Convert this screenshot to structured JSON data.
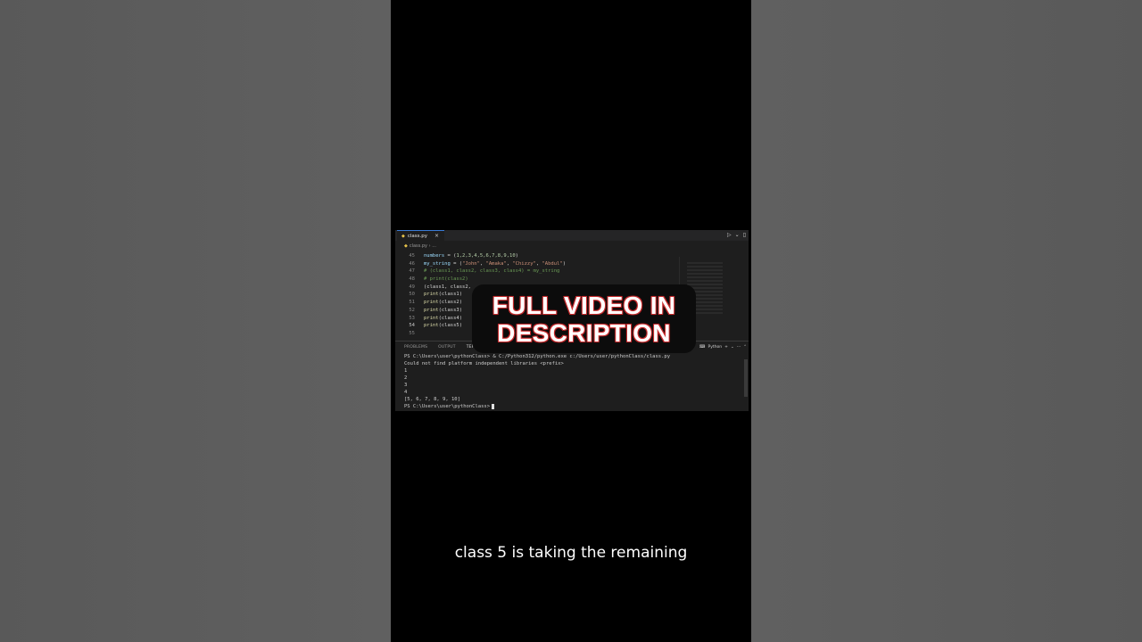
{
  "editor": {
    "tab_filename": "class.py",
    "tab_close": "×",
    "breadcrumb_file": "class.py",
    "breadcrumb_more": "...",
    "lines": [
      {
        "num": "45",
        "tokens": [
          [
            "var",
            "numbers"
          ],
          [
            "plain",
            " = ("
          ],
          [
            "num",
            "1,2,3,4,5,6,7,8,9,10"
          ],
          [
            "plain",
            ")"
          ]
        ]
      },
      {
        "num": "46",
        "tokens": [
          [
            "var",
            "my_string"
          ],
          [
            "plain",
            " = ("
          ],
          [
            "str",
            "\"John\""
          ],
          [
            "plain",
            ", "
          ],
          [
            "str",
            "\"Amaka\""
          ],
          [
            "plain",
            ", "
          ],
          [
            "str",
            "\"Chizzy\""
          ],
          [
            "plain",
            ", "
          ],
          [
            "str",
            "\"Abdul\""
          ],
          [
            "plain",
            ")"
          ]
        ]
      },
      {
        "num": "47",
        "tokens": [
          [
            "com",
            "# (class1, class2, class3, class4) = my_string"
          ]
        ]
      },
      {
        "num": "48",
        "tokens": [
          [
            "com",
            "# print(class2)"
          ]
        ]
      },
      {
        "num": "49",
        "tokens": [
          [
            "plain",
            "(class1, class2,"
          ]
        ]
      },
      {
        "num": "50",
        "tokens": [
          [
            "fn",
            "print"
          ],
          [
            "plain",
            "(class1)"
          ]
        ]
      },
      {
        "num": "51",
        "tokens": [
          [
            "fn",
            "print"
          ],
          [
            "plain",
            "(class2)"
          ]
        ]
      },
      {
        "num": "52",
        "tokens": [
          [
            "fn",
            "print"
          ],
          [
            "plain",
            "(class3)"
          ]
        ]
      },
      {
        "num": "53",
        "tokens": [
          [
            "fn",
            "print"
          ],
          [
            "plain",
            "(class4)"
          ]
        ]
      },
      {
        "num": "54",
        "tokens": [
          [
            "fn",
            "print"
          ],
          [
            "plain",
            "(class5)"
          ]
        ]
      },
      {
        "num": "55",
        "tokens": []
      }
    ]
  },
  "panel": {
    "tabs": [
      "PROBLEMS",
      "OUTPUT",
      "TERMINAL"
    ],
    "shell_label": "Python",
    "terminal_lines": [
      "PS C:\\Users\\user\\pythonClass> & C:/Python312/python.exe c:/Users/user/pythonClass/class.py",
      "Could not find platform independent libraries <prefix>",
      "1",
      "2",
      "3",
      "4",
      "[5, 6, 7, 8, 9, 10]"
    ],
    "prompt": "PS C:\\Users\\user\\pythonClass>"
  },
  "overlay": {
    "line1": "FULL VIDEO IN",
    "line2": "DESCRIPTION"
  },
  "caption": "class 5 is taking the remaining"
}
